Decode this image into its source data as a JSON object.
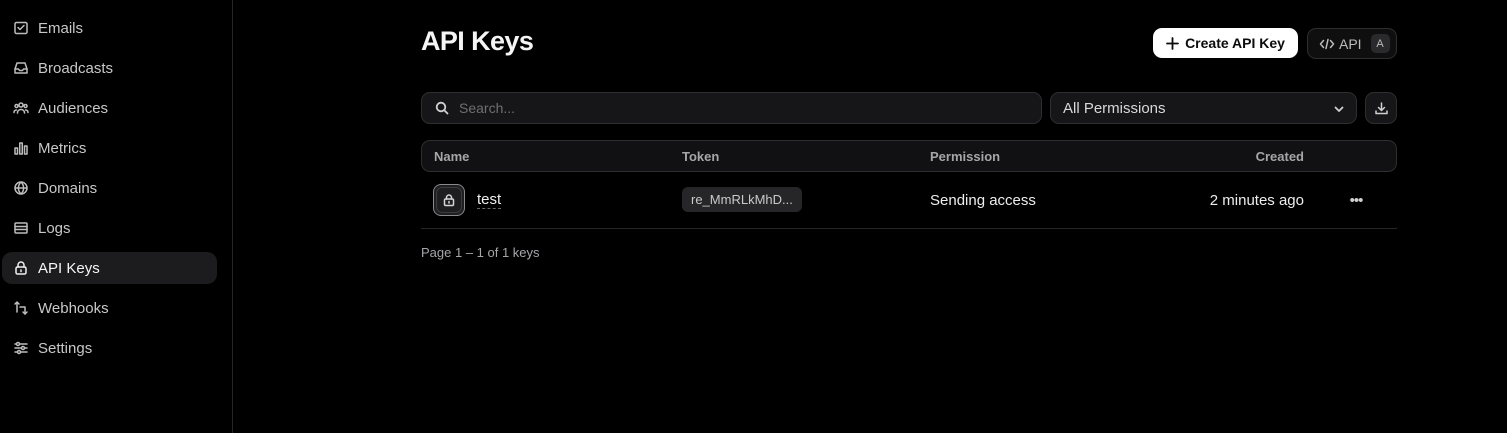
{
  "sidebar": {
    "items": [
      {
        "label": "Emails",
        "icon": "mail-icon"
      },
      {
        "label": "Broadcasts",
        "icon": "inbox-icon"
      },
      {
        "label": "Audiences",
        "icon": "users-icon"
      },
      {
        "label": "Metrics",
        "icon": "bar-chart-icon"
      },
      {
        "label": "Domains",
        "icon": "globe-icon"
      },
      {
        "label": "Logs",
        "icon": "list-icon"
      },
      {
        "label": "API Keys",
        "icon": "lock-icon",
        "active": true
      },
      {
        "label": "Webhooks",
        "icon": "webhook-icon"
      },
      {
        "label": "Settings",
        "icon": "sliders-icon"
      }
    ]
  },
  "header": {
    "title": "API Keys",
    "create_label": "Create API Key",
    "api_label": "API",
    "api_shortcut": "A"
  },
  "filters": {
    "search_placeholder": "Search...",
    "search_value": "",
    "permission_selected": "All Permissions"
  },
  "table": {
    "columns": {
      "name": "Name",
      "token": "Token",
      "permission": "Permission",
      "created": "Created"
    },
    "rows": [
      {
        "name": "test",
        "token": "re_MmRLkMhD...",
        "permission": "Sending access",
        "created": "2 minutes ago"
      }
    ]
  },
  "pagination": {
    "text": "Page 1 – 1 of 1 keys"
  },
  "colors": {
    "background": "#000000",
    "accent": "#ffffff",
    "active_nav": "#1c1c1e"
  }
}
